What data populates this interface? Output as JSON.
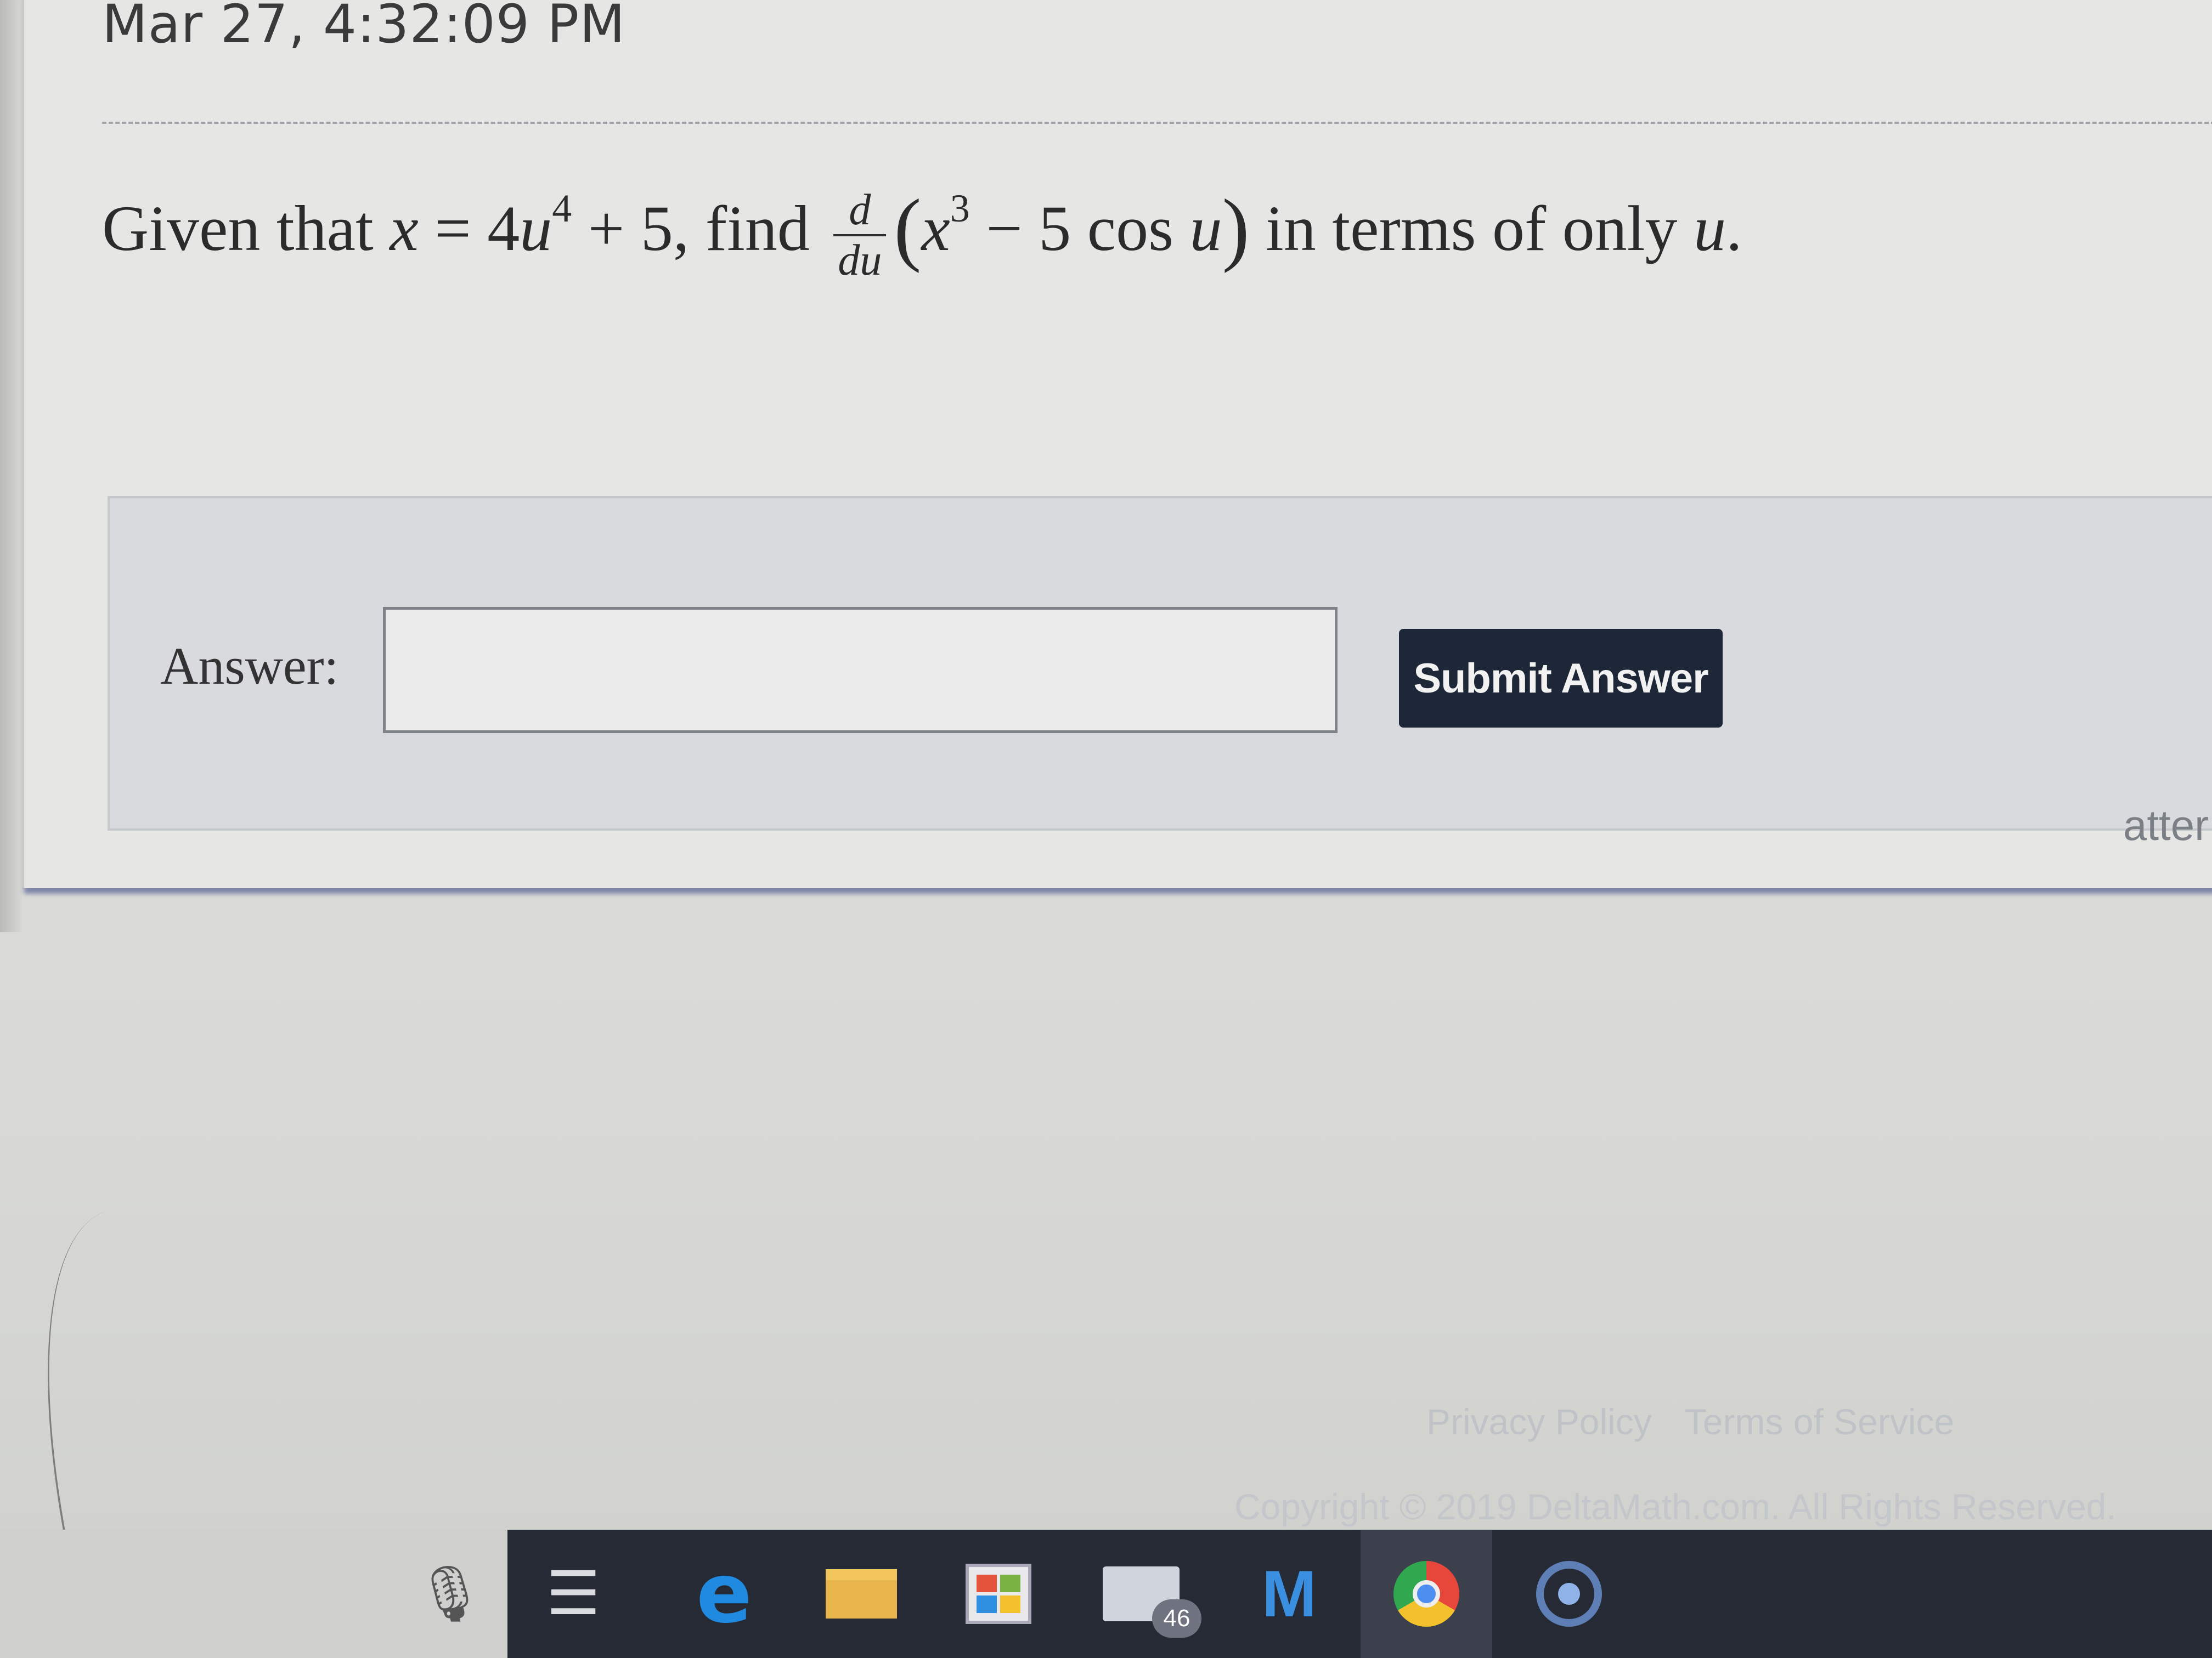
{
  "header": {
    "timestamp": "Mar 27, 4:32:09 PM"
  },
  "question": {
    "prefix": "Given that ",
    "var_x": "x",
    "equals": " = 4",
    "var_u1": "u",
    "exp_4": "4",
    "plus5": " + 5, find ",
    "frac_num": "d",
    "frac_den": "du",
    "open_paren": "(",
    "var_x2": "x",
    "exp_3": "3",
    "minus": " − 5 cos ",
    "var_u2": "u",
    "close_paren": ")",
    "suffix": " in terms of only ",
    "var_u3": "u",
    "period": "."
  },
  "answer": {
    "label": "Answer:",
    "input_value": "",
    "submit_label": "Submit Answer",
    "attempts_text": "atter"
  },
  "footer": {
    "privacy": "Privacy Policy",
    "terms": "Terms of Service",
    "copyright": "Copyright © 2019 DeltaMath.com. All Rights Reserved."
  },
  "taskbar": {
    "icons": [
      "microphone-icon",
      "task-view-icon",
      "edge-icon",
      "file-explorer-icon",
      "store-icon",
      "mail-icon",
      "mcafee-icon",
      "chrome-icon",
      "cortana-icon"
    ],
    "mail_badge": "46",
    "edge_glyph": "e",
    "mcafee_glyph": "M"
  },
  "colors": {
    "submit_button": "#1d2737",
    "panel": "#d8dade",
    "taskbar": "#262a35"
  }
}
